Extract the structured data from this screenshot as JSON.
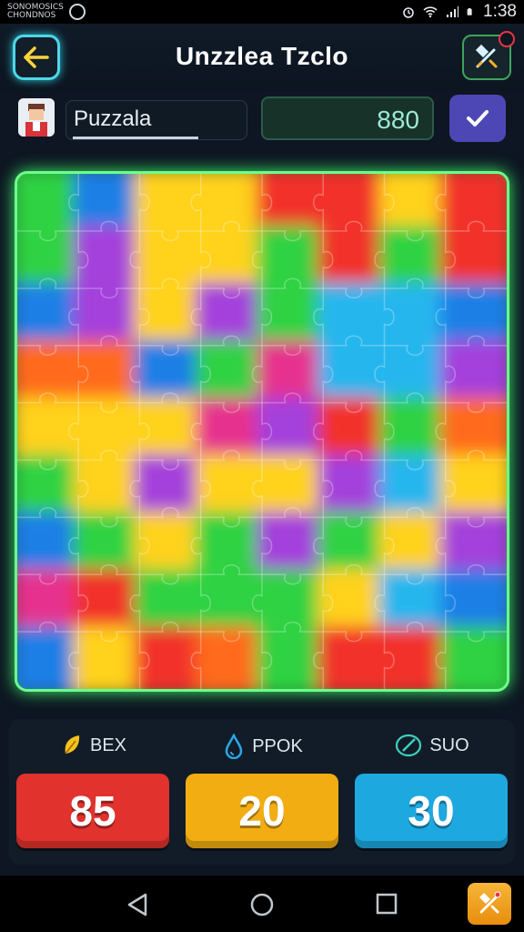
{
  "status_bar": {
    "logo_line1": "SONOMOSICS",
    "logo_line2": "CHONDNOS",
    "time": "1:38"
  },
  "header": {
    "title": "Unzzlea Tzclo",
    "back_icon": "arrow-left-icon",
    "tools_icon": "hammer-wrench-icon"
  },
  "player": {
    "name_value": "Puzzala",
    "score_value": "880",
    "confirm_icon": "check-icon"
  },
  "board": {
    "grid_size": 8,
    "colors": {
      "red": "#f2322a",
      "orange": "#ff6a1c",
      "yellow": "#ffd21a",
      "green": "#2fd243",
      "blue": "#1f7fe6",
      "cyan": "#26b6ee",
      "purple": "#a43fdc",
      "magenta": "#e6308e"
    },
    "cells": [
      [
        "green",
        "blue",
        "yellow",
        "yellow",
        "red",
        "red",
        "yellow",
        "red"
      ],
      [
        "green",
        "purple",
        "yellow",
        "yellow",
        "green",
        "red",
        "green",
        "red"
      ],
      [
        "blue",
        "purple",
        "yellow",
        "purple",
        "green",
        "cyan",
        "cyan",
        "blue"
      ],
      [
        "orange",
        "orange",
        "blue",
        "green",
        "magenta",
        "cyan",
        "cyan",
        "purple"
      ],
      [
        "yellow",
        "yellow",
        "yellow",
        "magenta",
        "purple",
        "red",
        "green",
        "orange"
      ],
      [
        "green",
        "yellow",
        "purple",
        "yellow",
        "yellow",
        "purple",
        "cyan",
        "yellow"
      ],
      [
        "blue",
        "green",
        "yellow",
        "green",
        "purple",
        "green",
        "yellow",
        "purple"
      ],
      [
        "magenta",
        "red",
        "green",
        "green",
        "green",
        "yellow",
        "cyan",
        "blue"
      ],
      [
        "blue",
        "yellow",
        "red",
        "orange",
        "green",
        "red",
        "red",
        "green"
      ]
    ]
  },
  "stats": [
    {
      "label": "BEX",
      "value": "85",
      "icon": "leaf-icon",
      "icon_color": "#f6c21c",
      "tile_color": "#e1322e"
    },
    {
      "label": "PPOK",
      "value": "20",
      "icon": "drop-icon",
      "icon_color": "#2aa6e8",
      "tile_color": "#f2ad12"
    },
    {
      "label": "SUO",
      "value": "30",
      "icon": "pen-icon",
      "icon_color": "#3fd0c0",
      "tile_color": "#1ea8e0"
    }
  ],
  "nav": {
    "back_icon": "triangle-back-icon",
    "home_icon": "circle-home-icon",
    "recents_icon": "square-recents-icon",
    "tools_icon": "hammer-wrench-icon"
  }
}
